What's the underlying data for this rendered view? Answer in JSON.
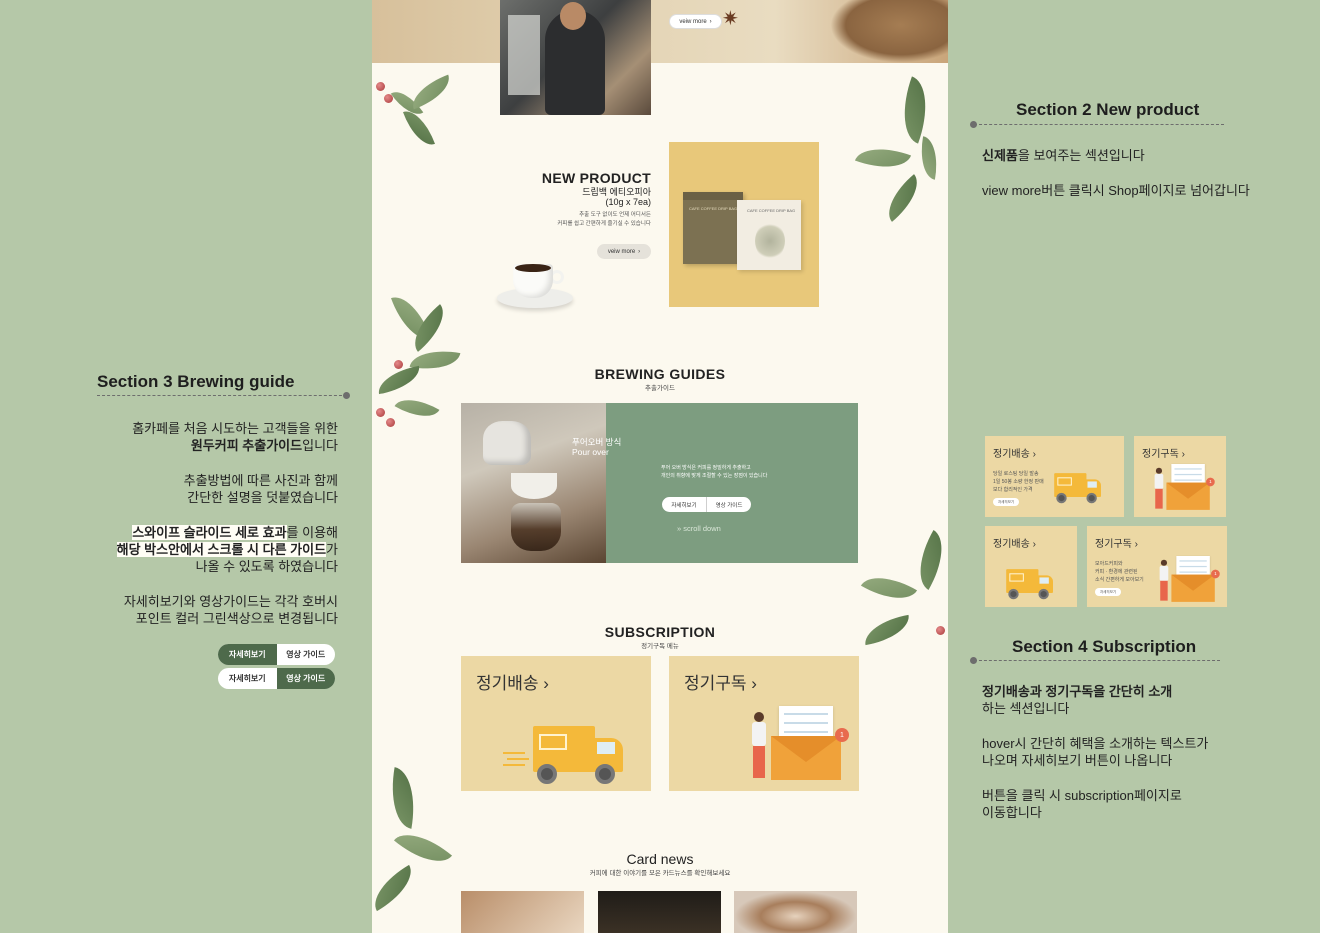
{
  "hero": {
    "view_more": "veiw more"
  },
  "new_product": {
    "title": "NEW PRODUCT",
    "name_line1": "드립백 에티오피아",
    "name_line2": "(10g x 7ea)",
    "desc_line1": "추출 도구 없이도 언제 어디서든",
    "desc_line2": "커피를 쉽고 간편하게 즐기실 수 있습니다",
    "view_more": "veiw more",
    "pack_label": "CAFE COFFEE DRIP BAG"
  },
  "brewing": {
    "title": "BREWING GUIDES",
    "subtitle": "추출가이드",
    "method_ko": "푸어오버 방식",
    "method_en": "Pour over",
    "desc_line1": "푸어 오버 방식은 커피를 정밀하게 추출하고",
    "desc_line2": "개인의 취향에 맞게 조절할 수 있는 장점이 있습니다",
    "btn_detail": "자세히보기",
    "btn_video": "영상 가이드",
    "scroll": "scroll down"
  },
  "subscription": {
    "title": "SUBSCRIPTION",
    "subtitle": "정기구독 메뉴",
    "card1": "정기배송 ›",
    "card2": "정기구독 ›",
    "badge": "1"
  },
  "card_news": {
    "title": "Card news",
    "subtitle": "커피에 대한 이야기를 모은 카드뉴스를 확인해보세요"
  },
  "ann_section2": {
    "heading": "Section 2   New product",
    "line1_bold": "신제품",
    "line1_rest": "을 보여주는 섹션입니다",
    "line2": "view more버튼  클릭시 Shop페이지로 넘어갑니다"
  },
  "ann_section3": {
    "heading": "Section 3   Brewing guide",
    "p1_line1": "홈카페를 처음 시도하는 고객들을 위한",
    "p1_line2_bold": "원두커피 추출가이드",
    "p1_line2_rest": "입니다",
    "p2_line1": "추출방법에 따른 사진과 함께",
    "p2_line2": "간단한 설명을 덧붙였습니다",
    "p3_line1_hl": "스와이프 슬라이드 세로 효과",
    "p3_line1_rest": "를 이용해",
    "p3_line2_hl": "해당 박스안에서 스크롤 시 다른 가이드",
    "p3_line2_rest": "가",
    "p3_line3": "나올 수 있도록 하였습니다",
    "p4_line1": "자세히보기와 영상가이드는 각각 호버시",
    "p4_line2": "포인트 컬러 그린색상으로 변경됩니다",
    "toggle_detail": "자세히보기",
    "toggle_video": "영상 가이드"
  },
  "ann_section4": {
    "heading": "Section 4   Subscription",
    "p1_line1_bold": "정기배송과 정기구독을 간단히 소개",
    "p1_line2": "하는 섹션입니다",
    "p2_line1": "hover시 간단히 혜택을 소개하는 텍스트가",
    "p2_line2": "나오며 자세히보기 버튼이 나옵니다",
    "p3_line1": "버튼을 클릭 시 subscription페이지로",
    "p3_line2": "이동합니다",
    "mini_delivery": "정기배송 ›",
    "mini_subscribe": "정기구독 ›",
    "mini_delivery_desc1": "당일 로스팅 당일 발송",
    "mini_delivery_desc2": "1일 50봉 소량 한정 판매",
    "mini_delivery_desc3": "보다 합리적인 가격",
    "mini_subscribe_desc1": "모아드커피와",
    "mini_subscribe_desc2": "커피 · 환경에 관련된",
    "mini_subscribe_desc3": "소식 간편하게 모아보기",
    "mini_btn": "자세히보기"
  },
  "colors": {
    "background": "#b5c8a8",
    "page": "#fcf9ef",
    "brewing_green": "#7d9d80",
    "point_green": "#4e6a4b",
    "card_yellow": "#ecd8a4",
    "product_yellow": "#e8c87a"
  }
}
